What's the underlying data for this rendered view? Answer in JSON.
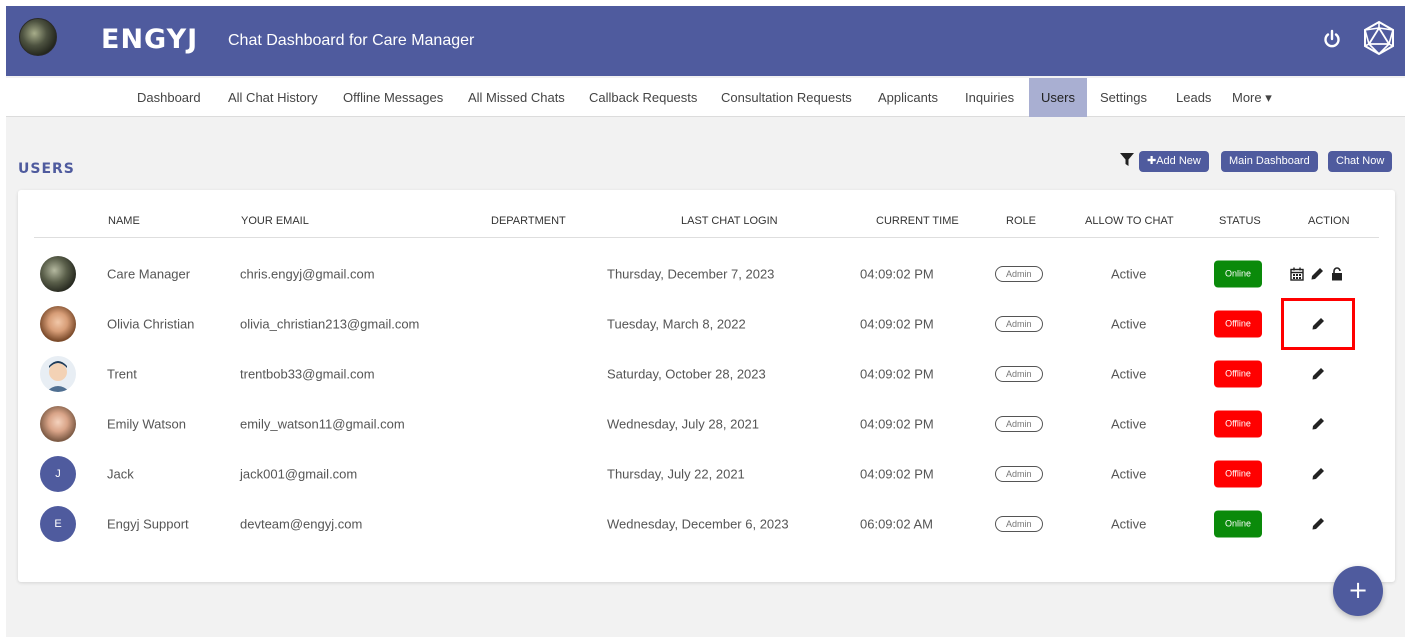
{
  "header": {
    "brand": "ENGYJ",
    "subtitle": "Chat Dashboard for Care Manager",
    "icons": [
      "avatar",
      "power-icon",
      "brand-logo-icon"
    ]
  },
  "nav": {
    "items": [
      "Dashboard",
      "All Chat History",
      "Offline Messages",
      "All Missed Chats",
      "Callback Requests",
      "Consultation Requests",
      "Applicants",
      "Inquiries",
      "Users",
      "Settings",
      "Leads",
      "More ▾"
    ],
    "active": "Users"
  },
  "page": {
    "title": "USERS",
    "buttons": {
      "add_new": "✚Add New",
      "main_dashboard": "Main Dashboard",
      "chat_now": "Chat Now"
    }
  },
  "table": {
    "headers": [
      "NAME",
      "YOUR EMAIL",
      "DEPARTMENT",
      "LAST CHAT LOGIN",
      "CURRENT TIME",
      "ROLE",
      "ALLOW TO CHAT",
      "STATUS",
      "ACTION"
    ],
    "rows": [
      {
        "avatar": "photo",
        "initial": "",
        "name": "Care Manager",
        "email": "chris.engyj@gmail.com",
        "department": "",
        "last_login": "Thursday, December 7, 2023",
        "time": "04:09:02 PM",
        "role": "Admin",
        "allow": "Active",
        "status": "Online"
      },
      {
        "avatar": "photo",
        "initial": "",
        "name": "Olivia Christian",
        "email": "olivia_christian213@gmail.com",
        "department": "",
        "last_login": "Tuesday, March 8, 2022",
        "time": "04:09:02 PM",
        "role": "Admin",
        "allow": "Active",
        "status": "Offline"
      },
      {
        "avatar": "photo",
        "initial": "",
        "name": "Trent",
        "email": "trentbob33@gmail.com",
        "department": "",
        "last_login": "Saturday, October 28, 2023",
        "time": "04:09:02 PM",
        "role": "Admin",
        "allow": "Active",
        "status": "Offline"
      },
      {
        "avatar": "photo",
        "initial": "",
        "name": "Emily Watson",
        "email": "emily_watson11@gmail.com",
        "department": "",
        "last_login": "Wednesday, July 28, 2021",
        "time": "04:09:02 PM",
        "role": "Admin",
        "allow": "Active",
        "status": "Offline"
      },
      {
        "avatar": "initial",
        "initial": "J",
        "name": "Jack",
        "email": "jack001@gmail.com",
        "department": "",
        "last_login": "Thursday, July 22, 2021",
        "time": "04:09:02 PM",
        "role": "Admin",
        "allow": "Active",
        "status": "Offline"
      },
      {
        "avatar": "initial",
        "initial": "E",
        "name": "Engyj Support",
        "email": "devteam@engyj.com",
        "department": "",
        "last_login": "Wednesday, December 6, 2023",
        "time": "06:09:02 AM",
        "role": "Admin",
        "allow": "Active",
        "status": "Online"
      }
    ]
  },
  "fab": {
    "label": "+"
  },
  "colors": {
    "primary": "#4f5b9e",
    "nav_active": "#a9afd2",
    "online": "#0a8a0a",
    "offline": "#ff0000",
    "highlight": "#ff0000"
  }
}
